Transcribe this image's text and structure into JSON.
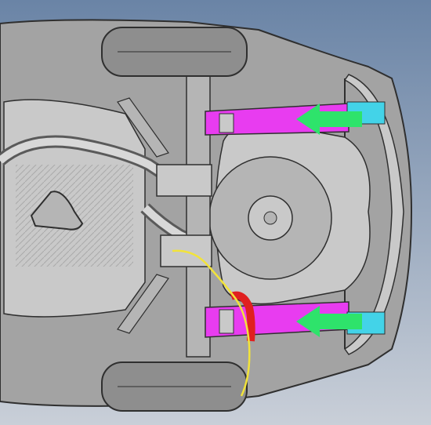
{
  "colors": {
    "background_top": "#6a84a6",
    "background_bottom": "#c9cfd8",
    "body_gray": "#a3a3a3",
    "panel_light": "#c9c9c9",
    "panel_mid": "#b5b5b5",
    "tire": "#8e8e8e",
    "magenta_rail": "#e83cf0",
    "green_arrow": "#2ee36b",
    "red_pipe": "#e02020",
    "yellow_line": "#f2e33a",
    "cyan_bracket": "#43d3e8",
    "outline": "#2f2f2f"
  },
  "diagram": {
    "highlights": [
      {
        "name": "upper-frame-rail",
        "color_key": "magenta_rail"
      },
      {
        "name": "lower-frame-rail",
        "color_key": "magenta_rail"
      },
      {
        "name": "upper-arrow",
        "color_key": "green_arrow",
        "direction": "left"
      },
      {
        "name": "lower-arrow",
        "color_key": "green_arrow",
        "direction": "left"
      },
      {
        "name": "fuel-filler-pipe",
        "color_key": "red_pipe"
      },
      {
        "name": "brake-line",
        "color_key": "yellow_line"
      }
    ]
  }
}
